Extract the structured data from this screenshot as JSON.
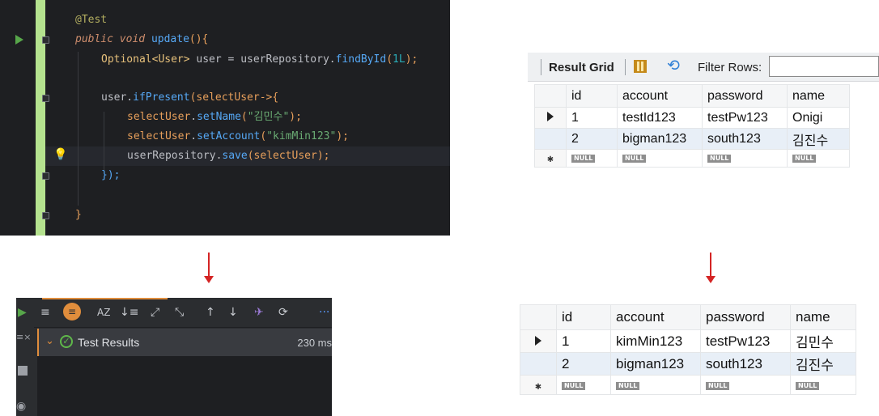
{
  "code": {
    "annotation": "@Test",
    "kw_public": "public",
    "kw_void": "void",
    "method_name": "update",
    "method_parens": "(){",
    "line3_type": "Optional<User>",
    "line3_var": " user = userRepository.",
    "line3_call": "findById",
    "line3_open": "(",
    "line3_arg": "1L",
    "line3_close": ");",
    "line5_user": "user.",
    "line5_call": "ifPresent",
    "line5_open": "(",
    "line5_param": "selectUser",
    "line5_arrow": "->{",
    "line6_obj": "selectUser",
    "line6_dot": ".",
    "line6_call": "setName",
    "line6_open": "(",
    "line6_arg": "\"김민수\"",
    "line6_close": ");",
    "line7_obj": "selectUser",
    "line7_dot": ".",
    "line7_call": "setAccount",
    "line7_open": "(",
    "line7_arg": "\"kimMin123\"",
    "line7_close": ");",
    "line8_repo": "userRepository.",
    "line8_call": "save",
    "line8_open": "(",
    "line8_arg": "selectUser",
    "line8_close": ");",
    "line9": "});",
    "line11": "}"
  },
  "grid_before": {
    "toolbar_result_grid": "Result Grid",
    "toolbar_filter": "Filter Rows:",
    "columns": [
      "id",
      "account",
      "password",
      "name"
    ],
    "rows": [
      [
        "1",
        "testId123",
        "testPw123",
        "Onigi"
      ],
      [
        "2",
        "bigman123",
        "south123",
        "김진수"
      ]
    ],
    "null_label": "NULL",
    "new_row_marker": "✱"
  },
  "grid_after": {
    "columns": [
      "id",
      "account",
      "password",
      "name"
    ],
    "rows": [
      [
        "1",
        "kimMin123",
        "testPw123",
        "김민수"
      ],
      [
        "2",
        "bigman123",
        "south123",
        "김진수"
      ]
    ],
    "null_label": "NULL",
    "new_row_marker": "✱"
  },
  "test_panel": {
    "result_label": "Test Results",
    "duration": "230 ms",
    "more": "···"
  },
  "colors": {
    "arrow": "#d42424",
    "pass": "#5fb84a",
    "accent_orange": "#e08d3c"
  }
}
